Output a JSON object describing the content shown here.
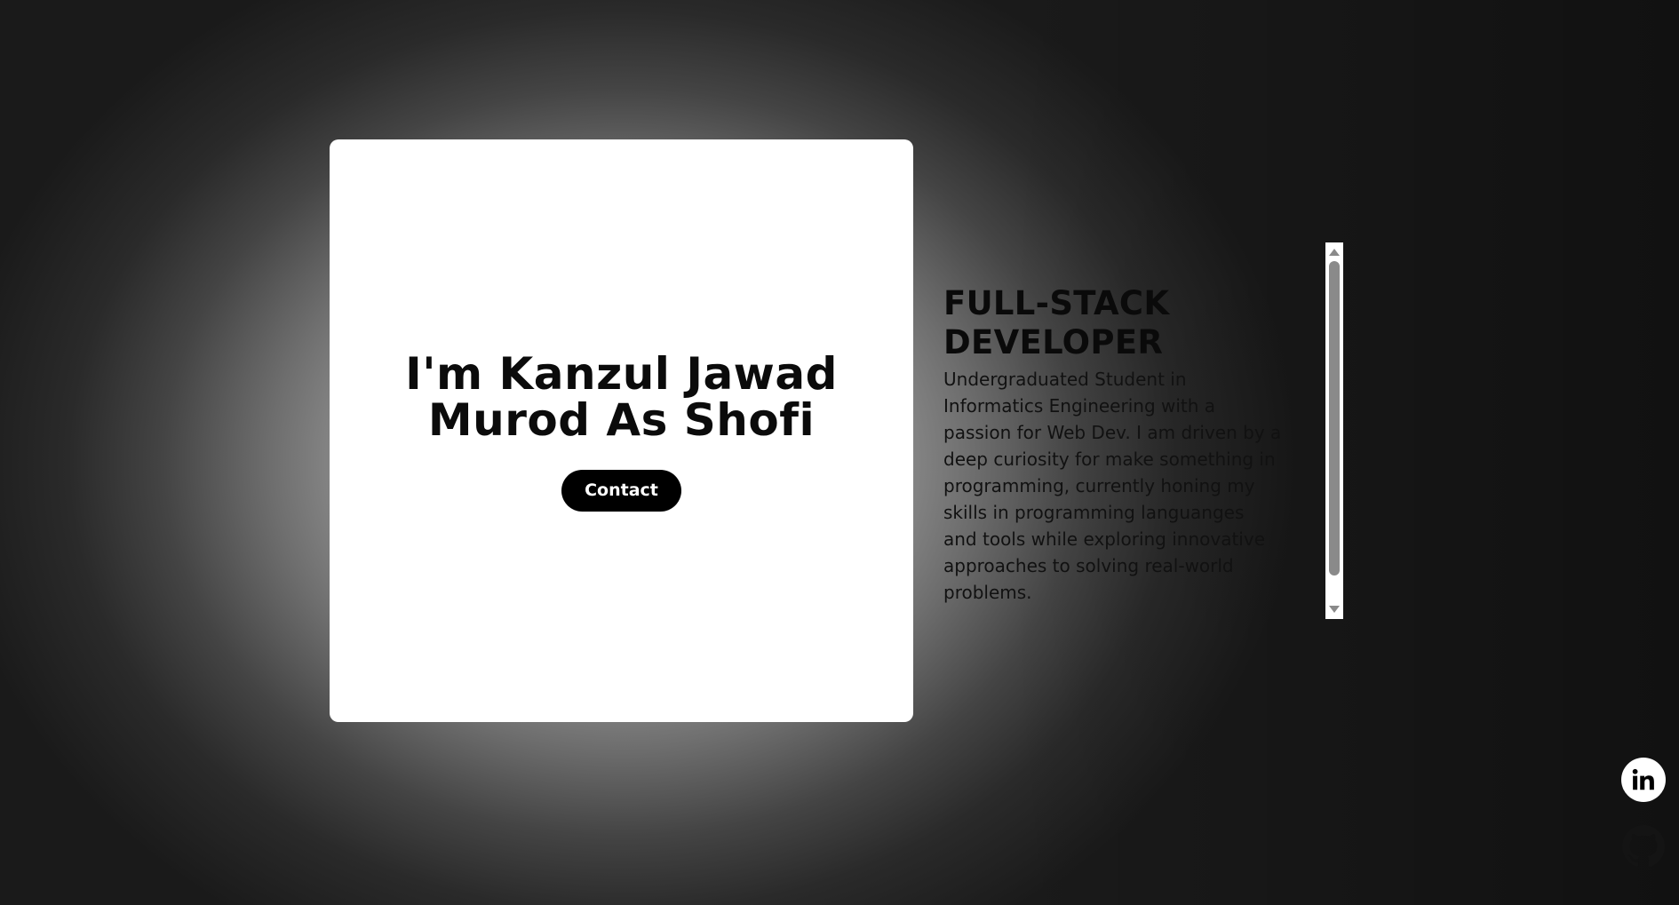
{
  "hero": {
    "title": "I'm Kanzul Jawad Murod As Shofi",
    "contact_label": "Contact"
  },
  "about": {
    "role": "FULL-STACK DEVELOPER",
    "bio": "Undergraduated Student in Informatics Engineering with a passion for Web Dev. I am driven by a deep curiosity for make something in programming, currently honing my skills in programming languanges and tools while exploring innovative approaches to solving real-world problems."
  },
  "social": {
    "icons": [
      "linkedin-icon",
      "github-icon"
    ]
  },
  "colors": {
    "card_background": "#ffffff",
    "button_background": "#000000",
    "button_text": "#ffffff",
    "text_dark": "#0b0b0b",
    "page_glow": "#cfcfcf",
    "page_dark": "#1a1a1a"
  }
}
